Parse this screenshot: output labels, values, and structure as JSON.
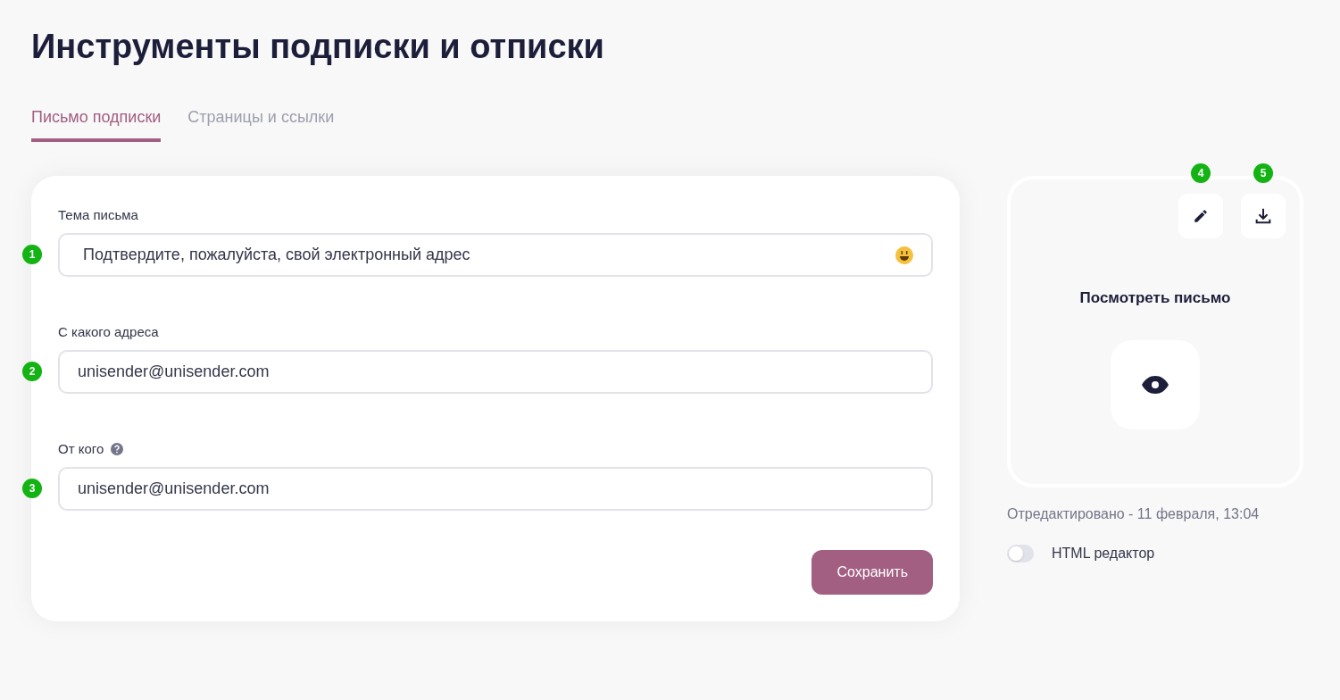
{
  "title": "Инструменты подписки и отписки",
  "tabs": [
    {
      "label": "Письмо подписки",
      "selected": true
    },
    {
      "label": "Страницы и ссылки",
      "selected": false
    }
  ],
  "form": {
    "fields": [
      {
        "label": "Тема письма",
        "value": "Подтвердите, пожалуйста, свой электронный адрес",
        "marker": "1",
        "emoji": true,
        "help": false
      },
      {
        "label": "С какого адреса",
        "value": "unisender@unisender.com",
        "marker": "2",
        "emoji": false,
        "help": false
      },
      {
        "label": "От кого",
        "value": "unisender@unisender.com",
        "marker": "3",
        "emoji": false,
        "help": true
      }
    ],
    "save_button": "Сохранить"
  },
  "preview": {
    "edit_marker": "4",
    "download_marker": "5",
    "title": "Посмотреть письмо",
    "edited": "Отредактировано - 11 февраля, 13:04",
    "html_editor": {
      "label": "HTML редактор",
      "on": false
    }
  }
}
